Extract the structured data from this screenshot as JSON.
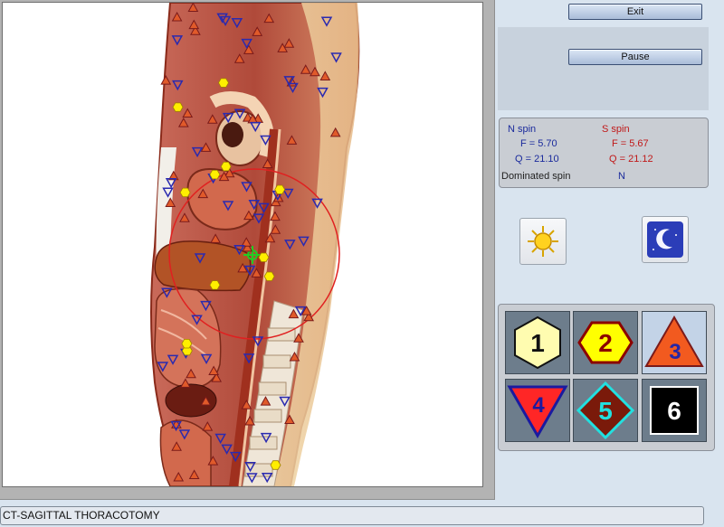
{
  "status_bar": {
    "text": "CT-SAGITTAL THORACOTOMY"
  },
  "controls": {
    "exit_label": "Exit",
    "pause_label": "Pause"
  },
  "spin": {
    "n_label": "N spin",
    "n_f": "F =  5.70",
    "n_q": "Q = 21.10",
    "s_label": "S spin",
    "s_f": "F =  5.67",
    "s_q": "Q = 21.12",
    "dominated_label": "Dominated spin",
    "dominated_value": "N"
  },
  "mode_buttons": [
    {
      "name": "day-mode",
      "icon": "sun-icon"
    },
    {
      "name": "night-mode",
      "icon": "moon-icon"
    }
  ],
  "marker_buttons": [
    {
      "label": "1",
      "shape": "hexagon",
      "fill": "#fffcb0",
      "stroke": "#111111",
      "text_color": "#111111"
    },
    {
      "label": "2",
      "shape": "hexagon",
      "fill": "#ffff00",
      "stroke": "#8b0000",
      "text_color": "#8b0000"
    },
    {
      "label": "3",
      "shape": "triangle-up",
      "fill": "#f25a1f",
      "stroke": "#7a1a1a",
      "text_color": "#2626a6"
    },
    {
      "label": "4",
      "shape": "triangle-down",
      "fill": "#ff2626",
      "stroke": "#1a1aa0",
      "text_color": "#1a1aa0"
    },
    {
      "label": "5",
      "shape": "diamond",
      "fill": "#7a1a0a",
      "stroke": "#22e0e0",
      "text_color": "#22e0e0"
    },
    {
      "label": "6",
      "shape": "square",
      "fill": "#000000",
      "stroke": "#ffffff",
      "text_color": "#ffffff"
    }
  ],
  "colors": {
    "background": "#d9e4ef",
    "n_spin": "#1a2a9c",
    "s_spin": "#c01818",
    "marker_triangle_fill": "#e05a2a",
    "marker_triangle_stroke": "#7a1a1a",
    "marker_invtriangle_stroke": "#2a2ab0",
    "marker_hexagon_fill": "#ffee00",
    "focus_circle": "#e02020",
    "crosshair": "#22cc22"
  },
  "markers": {
    "triangles": 62,
    "inverted_triangles": 52,
    "hexagons": 12
  }
}
